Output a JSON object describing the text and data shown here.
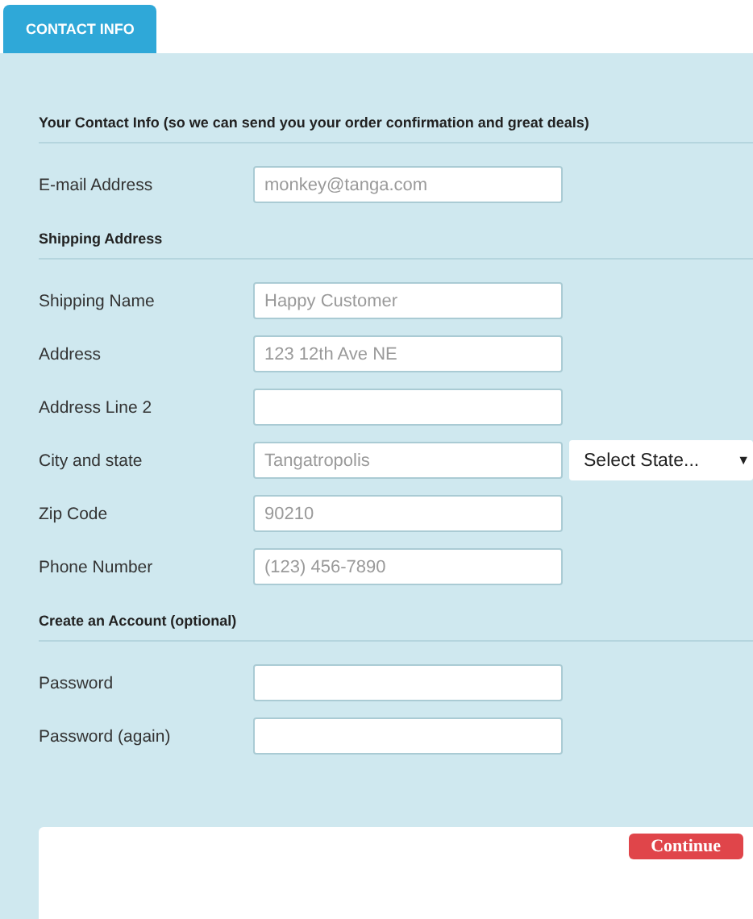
{
  "tab": {
    "label": "CONTACT INFO",
    "selected": true
  },
  "sections": [
    {
      "heading": "Your Contact Info (so we can send you your order confirmation and great deals)",
      "fields": [
        {
          "label": "E-mail Address",
          "placeholder": "monkey@tanga.com"
        }
      ]
    },
    {
      "heading": "Shipping Address",
      "fields": [
        {
          "label": "Shipping Name",
          "placeholder": "Happy Customer"
        },
        {
          "label": "Address",
          "placeholder": "123 12th Ave NE"
        },
        {
          "label": "Address Line 2"
        },
        {
          "label": "City and state",
          "placeholder": "Tangatropolis",
          "select": {
            "value": "Select State...",
            "arrow": "▼"
          }
        },
        {
          "label": "Zip Code",
          "placeholder": "90210"
        },
        {
          "label": "Phone Number",
          "placeholder": "(123) 456-7890"
        }
      ]
    },
    {
      "heading": "Create an Account (optional)",
      "fields": [
        {
          "label": "Password"
        },
        {
          "label": "Password (again)"
        }
      ]
    }
  ],
  "continue_button": "Continue"
}
